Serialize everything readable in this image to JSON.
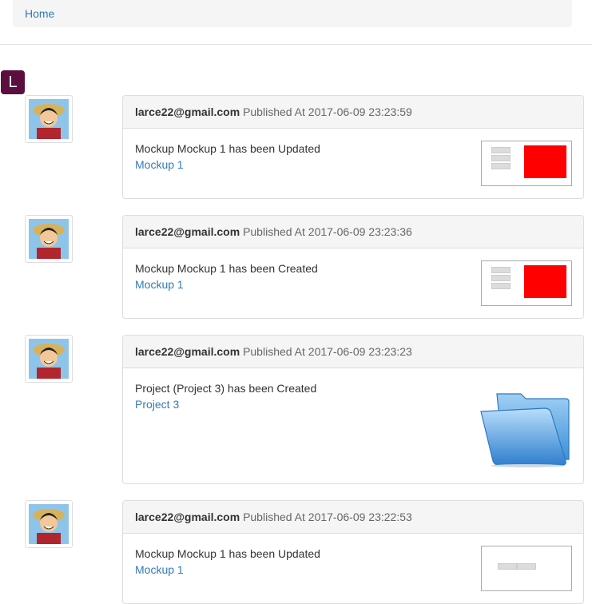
{
  "nav": {
    "home_label": "Home"
  },
  "user_badge": "L",
  "feed": [
    {
      "email": "larce22@gmail.com",
      "published": "Published At 2017-06-09 23:23:59",
      "message": "Mockup Mockup 1 has been Updated",
      "link": "Mockup 1",
      "thumb": "mockup-red"
    },
    {
      "email": "larce22@gmail.com",
      "published": "Published At 2017-06-09 23:23:36",
      "message": "Mockup Mockup 1 has been Created",
      "link": "Mockup 1",
      "thumb": "mockup-red"
    },
    {
      "email": "larce22@gmail.com",
      "published": "Published At 2017-06-09 23:23:23",
      "message": "Project (Project 3) has been Created",
      "link": "Project 3",
      "thumb": "folder-icon"
    },
    {
      "email": "larce22@gmail.com",
      "published": "Published At 2017-06-09 23:22:53",
      "message": "Mockup Mockup 1 has been Updated",
      "link": "Mockup 1",
      "thumb": "mockup-blank"
    }
  ]
}
